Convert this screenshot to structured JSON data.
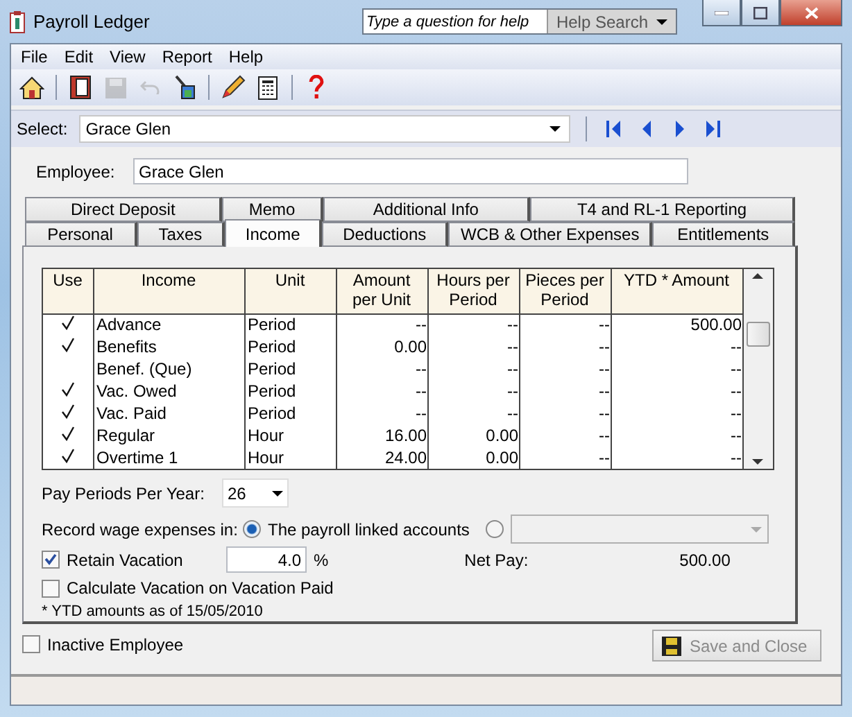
{
  "window": {
    "title": "Payroll Ledger",
    "help_placeholder": "Type a question for help",
    "help_button": "Help Search"
  },
  "menu": [
    "File",
    "Edit",
    "View",
    "Report",
    "Help"
  ],
  "toolbar": [
    {
      "kind": "home",
      "disabled": false
    },
    {
      "kind": "book",
      "disabled": false
    },
    {
      "kind": "save",
      "disabled": true
    },
    {
      "kind": "undo",
      "disabled": true
    },
    {
      "kind": "clear",
      "disabled": false
    },
    {
      "kind": "pencil",
      "disabled": false
    },
    {
      "kind": "calculator",
      "disabled": false
    },
    {
      "kind": "help",
      "disabled": false
    }
  ],
  "select": {
    "label": "Select:",
    "value": "Grace Glen"
  },
  "employee": {
    "label": "Employee:",
    "value": "Grace Glen"
  },
  "tab_rows": [
    [
      {
        "label": "Direct Deposit",
        "selected": false
      },
      {
        "label": "Memo",
        "selected": false
      },
      {
        "label": "Additional Info",
        "selected": false
      },
      {
        "label": "T4 and RL-1 Reporting",
        "selected": false
      }
    ],
    [
      {
        "label": "Personal",
        "selected": false
      },
      {
        "label": "Taxes",
        "selected": false
      },
      {
        "label": "Income",
        "selected": true
      },
      {
        "label": "Deductions",
        "selected": false
      },
      {
        "label": "WCB & Other Expenses",
        "selected": false
      },
      {
        "label": "Entitlements",
        "selected": false
      }
    ]
  ],
  "table": {
    "columns": [
      "Use",
      "Income",
      "Unit",
      "Amount per Unit",
      "Hours per Period",
      "Pieces per Period",
      "YTD * Amount"
    ],
    "rows": [
      {
        "use": true,
        "income": "Advance",
        "unit": "Period",
        "amount": "--",
        "hours": "--",
        "pieces": "--",
        "ytd": "500.00"
      },
      {
        "use": true,
        "income": "Benefits",
        "unit": "Period",
        "amount": "0.00",
        "hours": "--",
        "pieces": "--",
        "ytd": "--"
      },
      {
        "use": false,
        "income": "Benef. (Que)",
        "unit": "Period",
        "amount": "--",
        "hours": "--",
        "pieces": "--",
        "ytd": "--"
      },
      {
        "use": true,
        "income": "Vac. Owed",
        "unit": "Period",
        "amount": "--",
        "hours": "--",
        "pieces": "--",
        "ytd": "--"
      },
      {
        "use": true,
        "income": "Vac. Paid",
        "unit": "Period",
        "amount": "--",
        "hours": "--",
        "pieces": "--",
        "ytd": "--"
      },
      {
        "use": true,
        "income": "Regular",
        "unit": "Hour",
        "amount": "16.00",
        "hours": "0.00",
        "pieces": "--",
        "ytd": "--"
      },
      {
        "use": true,
        "income": "Overtime 1",
        "unit": "Hour",
        "amount": "24.00",
        "hours": "0.00",
        "pieces": "--",
        "ytd": "--"
      }
    ]
  },
  "pay_periods": {
    "label": "Pay Periods Per Year:",
    "value": "26"
  },
  "record": {
    "label": "Record wage expenses in:",
    "options": [
      {
        "label": "The payroll linked accounts",
        "selected": true
      },
      {
        "selected": false
      }
    ]
  },
  "retain": {
    "label": "Retain Vacation",
    "checked": true,
    "value": "4.0",
    "unit": "%"
  },
  "calc": {
    "label": "Calculate Vacation on Vacation Paid",
    "checked": false
  },
  "net_pay": {
    "label": "Net Pay:",
    "value": "500.00"
  },
  "note": "* YTD amounts as of 15/05/2010",
  "inactive": {
    "label": "Inactive Employee",
    "checked": false
  },
  "save_button": {
    "label": "Save and Close",
    "disabled": true
  }
}
